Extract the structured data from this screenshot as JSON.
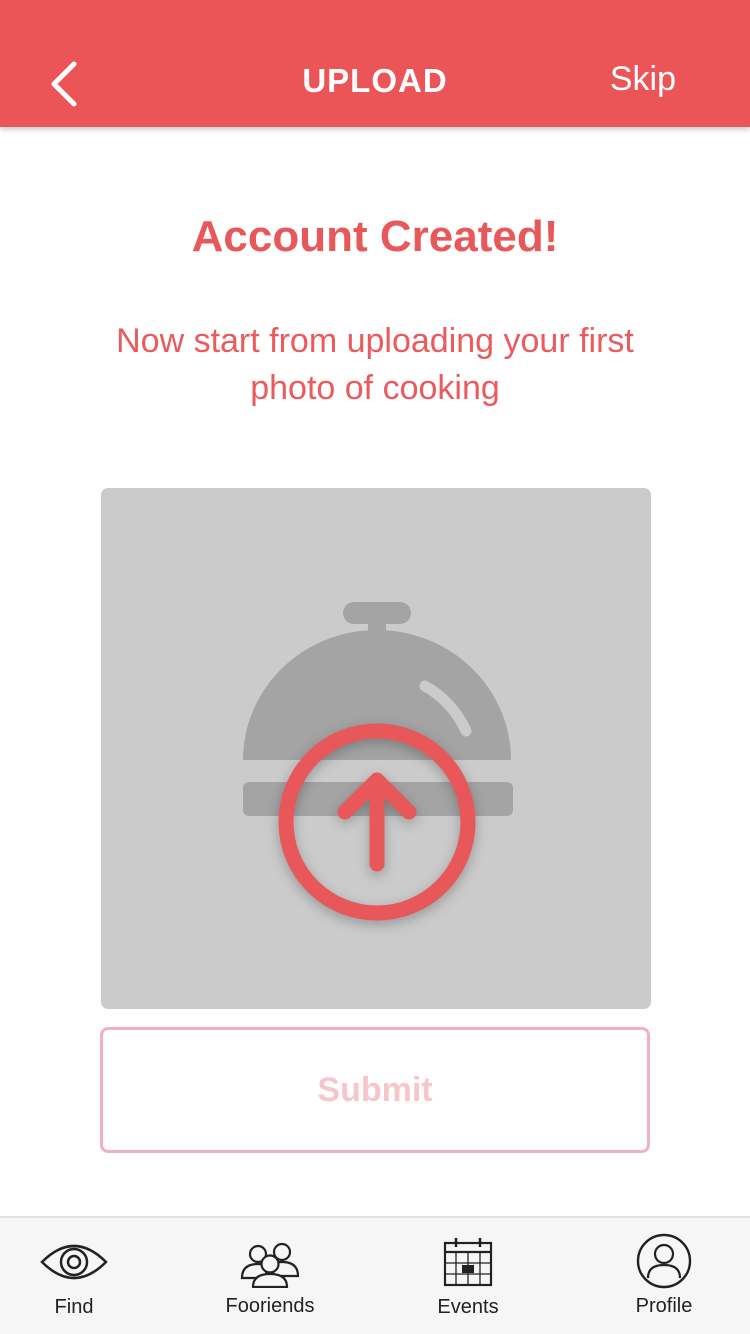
{
  "header": {
    "title": "UPLOAD",
    "skip_label": "Skip",
    "back_icon": "chevron-left-icon"
  },
  "main": {
    "headline": "Account Created!",
    "subtext": "Now start from uploading your first photo of cooking",
    "placeholder_icon": "cloche-icon",
    "upload_icon": "upload-arrow-circle-icon",
    "submit_label": "Submit"
  },
  "tabs": [
    {
      "label": "Find",
      "icon": "eye-icon"
    },
    {
      "label": "Fooriends",
      "icon": "people-icon"
    },
    {
      "label": "Events",
      "icon": "calendar-icon"
    },
    {
      "label": "Profile",
      "icon": "user-circle-icon"
    }
  ],
  "colors": {
    "accent": "#eb5558",
    "placeholder_bg": "#cbcbcb",
    "submit_border": "#f2b1c0",
    "submit_text": "#f7c6cb"
  }
}
